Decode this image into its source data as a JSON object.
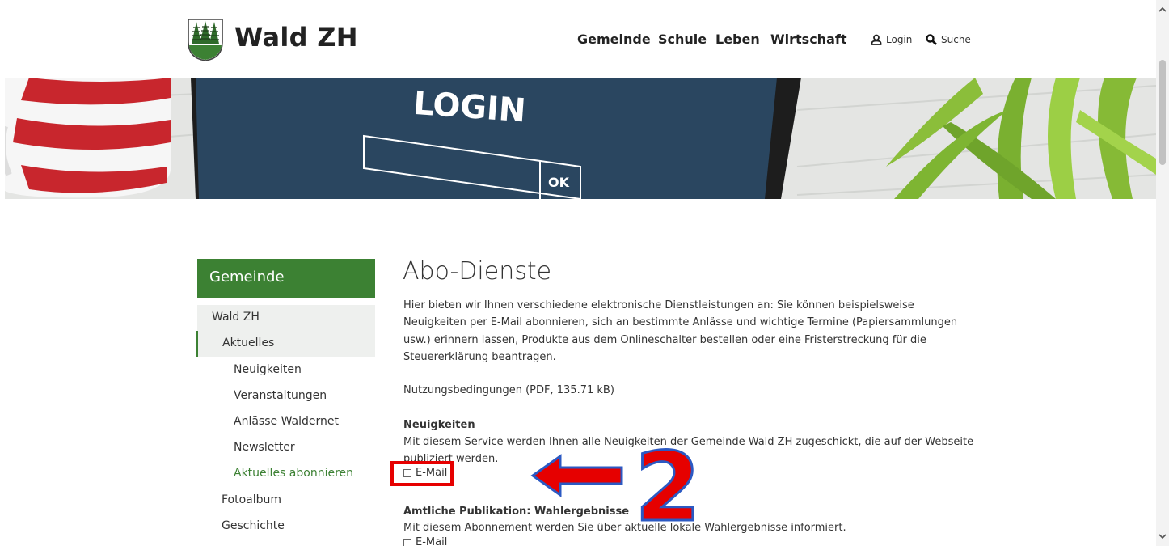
{
  "site": {
    "name": "Wald ZH"
  },
  "header": {
    "nav": [
      "Gemeinde",
      "Schule",
      "Leben",
      "Wirtschaft"
    ],
    "login_label": "Login",
    "search_label": "Suche"
  },
  "hero": {
    "login_text": "LOGIN",
    "ok_text": "OK"
  },
  "sidebar": {
    "title": "Gemeinde",
    "items": [
      {
        "label": "Wald ZH"
      },
      {
        "label": "Aktuelles"
      },
      {
        "label": "Neuigkeiten"
      },
      {
        "label": "Veranstaltungen"
      },
      {
        "label": "Anlässe Waldernet"
      },
      {
        "label": "Newsletter"
      },
      {
        "label": "Aktuelles abonnieren"
      },
      {
        "label": "Fotoalbum"
      },
      {
        "label": "Geschichte"
      }
    ]
  },
  "main": {
    "title": "Abo-Dienste",
    "intro_lines": [
      "Hier bieten wir Ihnen verschiedene elektronische Dienstleistungen an: Sie können beispielsweise",
      "Neuigkeiten per E-Mail abonnieren, sich an bestimmte Anlässe und wichtige Termine (Papiersammlungen",
      "usw.) erinnern lassen, Produkte aus dem Onlineschalter bestellen oder eine Fristerstreckung für die",
      "Steuererklärung beantragen."
    ],
    "terms_link": "Nutzungsbedingungen (PDF, 135.71 kB)",
    "sections": [
      {
        "title": "Neuigkeiten",
        "desc_lines": [
          "Mit diesem Service werden Ihnen alle Neuigkeiten der Gemeinde Wald ZH zugeschickt, die auf der Webseite",
          "publiziert werden."
        ],
        "checkbox_label": "E-Mail"
      },
      {
        "title": "Amtliche Publikation: Wahlergebnisse",
        "desc_lines": [
          "Mit diesem Abonnement werden Sie über aktuelle lokale Wahlergebnisse informiert."
        ],
        "checkbox_label": "E-Mail"
      }
    ]
  },
  "annotation": {
    "step_number": "2",
    "color": "#e60000"
  },
  "colors": {
    "brand_green": "#3c8133",
    "annotation_blue": "#2b59c3"
  }
}
